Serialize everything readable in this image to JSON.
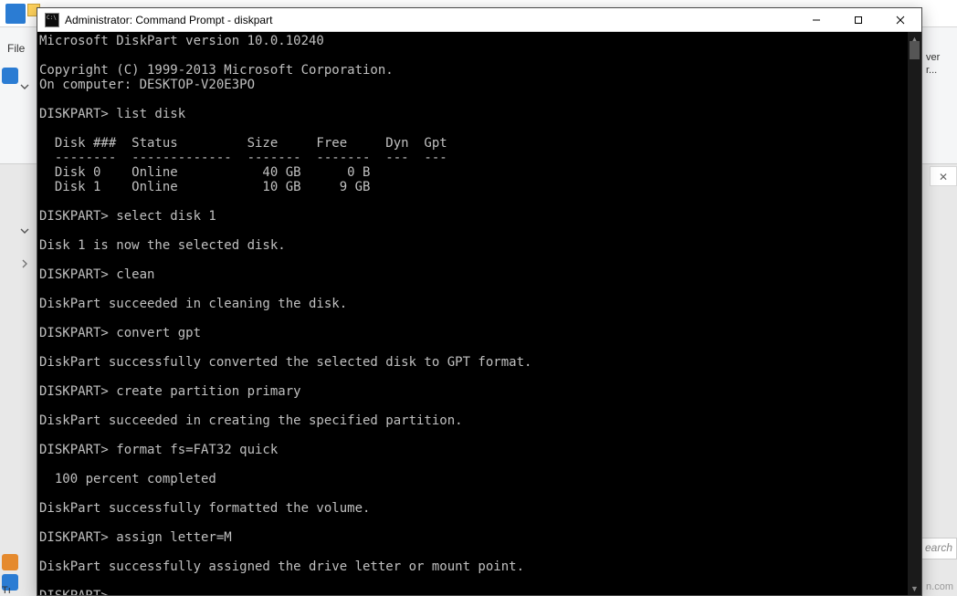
{
  "window": {
    "title": "Administrator: Command Prompt - diskpart"
  },
  "terminal": {
    "lines": [
      "Microsoft DiskPart version 10.0.10240",
      "",
      "Copyright (C) 1999-2013 Microsoft Corporation.",
      "On computer: DESKTOP-V20E3PO",
      "",
      "DISKPART> list disk",
      "",
      "  Disk ###  Status         Size     Free     Dyn  Gpt",
      "  --------  -------------  -------  -------  ---  ---",
      "  Disk 0    Online           40 GB      0 B",
      "  Disk 1    Online           10 GB     9 GB",
      "",
      "DISKPART> select disk 1",
      "",
      "Disk 1 is now the selected disk.",
      "",
      "DISKPART> clean",
      "",
      "DiskPart succeeded in cleaning the disk.",
      "",
      "DISKPART> convert gpt",
      "",
      "DiskPart successfully converted the selected disk to GPT format.",
      "",
      "DISKPART> create partition primary",
      "",
      "DiskPart succeeded in creating the specified partition.",
      "",
      "DISKPART> format fs=FAT32 quick",
      "",
      "  100 percent completed",
      "",
      "DiskPart successfully formatted the volume.",
      "",
      "DISKPART> assign letter=M",
      "",
      "DiskPart successfully assigned the drive letter or mount point.",
      "",
      "DISKPART>"
    ]
  },
  "background": {
    "file_menu": "File",
    "over_label_1": "ver",
    "over_label_2": "r...",
    "search_placeholder": "earch",
    "watermark": "n.com",
    "tu_fragment": "Tı"
  }
}
